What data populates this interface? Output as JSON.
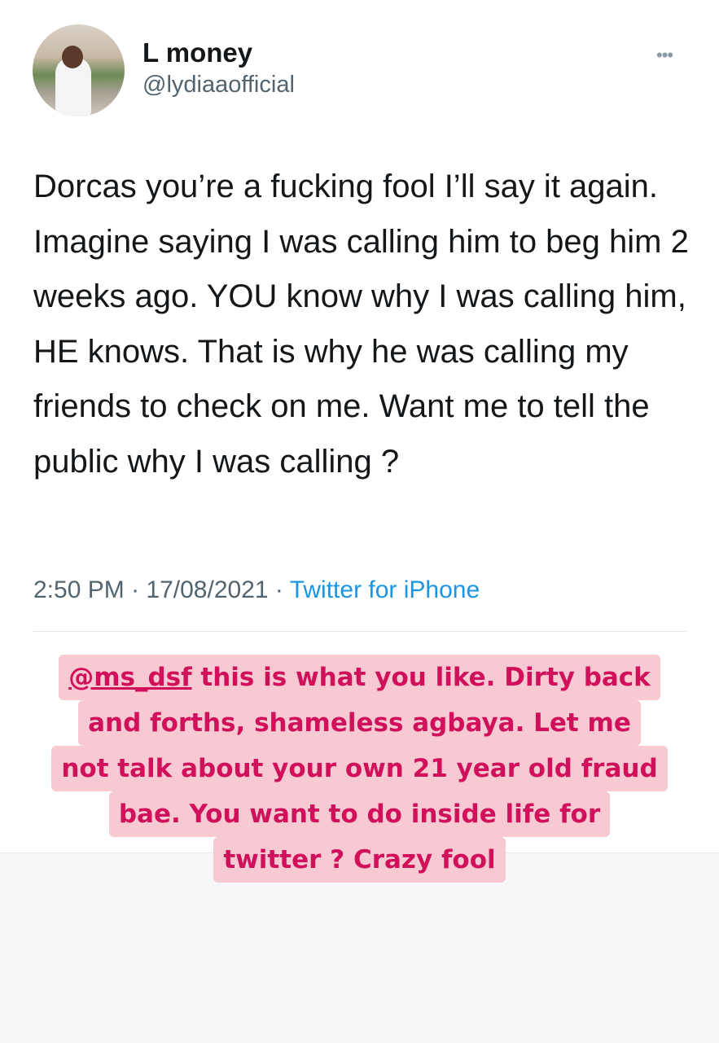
{
  "tweet": {
    "author_name": "L money",
    "author_handle": "@lydiaaofficial",
    "more_label": "•••",
    "text": "Dorcas you’re a fucking fool I’ll say it again. Imagine saying I was calling him to beg him 2 weeks ago. YOU know why I was calling him, HE knows. That is why he was calling my friends to check on me. Want me to tell the public why I was calling ?",
    "time": "2:50 PM",
    "date": "17/08/2021",
    "separator": "·",
    "source": "Twitter for iPhone"
  },
  "caption": {
    "mention": "@ms_dsf",
    "line1_rest": " this is what you like. Dirty back",
    "line2": "and forths, shameless agbaya. Let me",
    "line3": "not talk about your own 21 year old fraud",
    "line4": "bae. You want to do inside life for",
    "line5": "twitter ? Crazy fool"
  },
  "colors": {
    "text": "#14171a",
    "secondary": "#536471",
    "link": "#1b95e0",
    "caption_text": "#d0105a",
    "caption_bg": "#f7c9d2"
  }
}
